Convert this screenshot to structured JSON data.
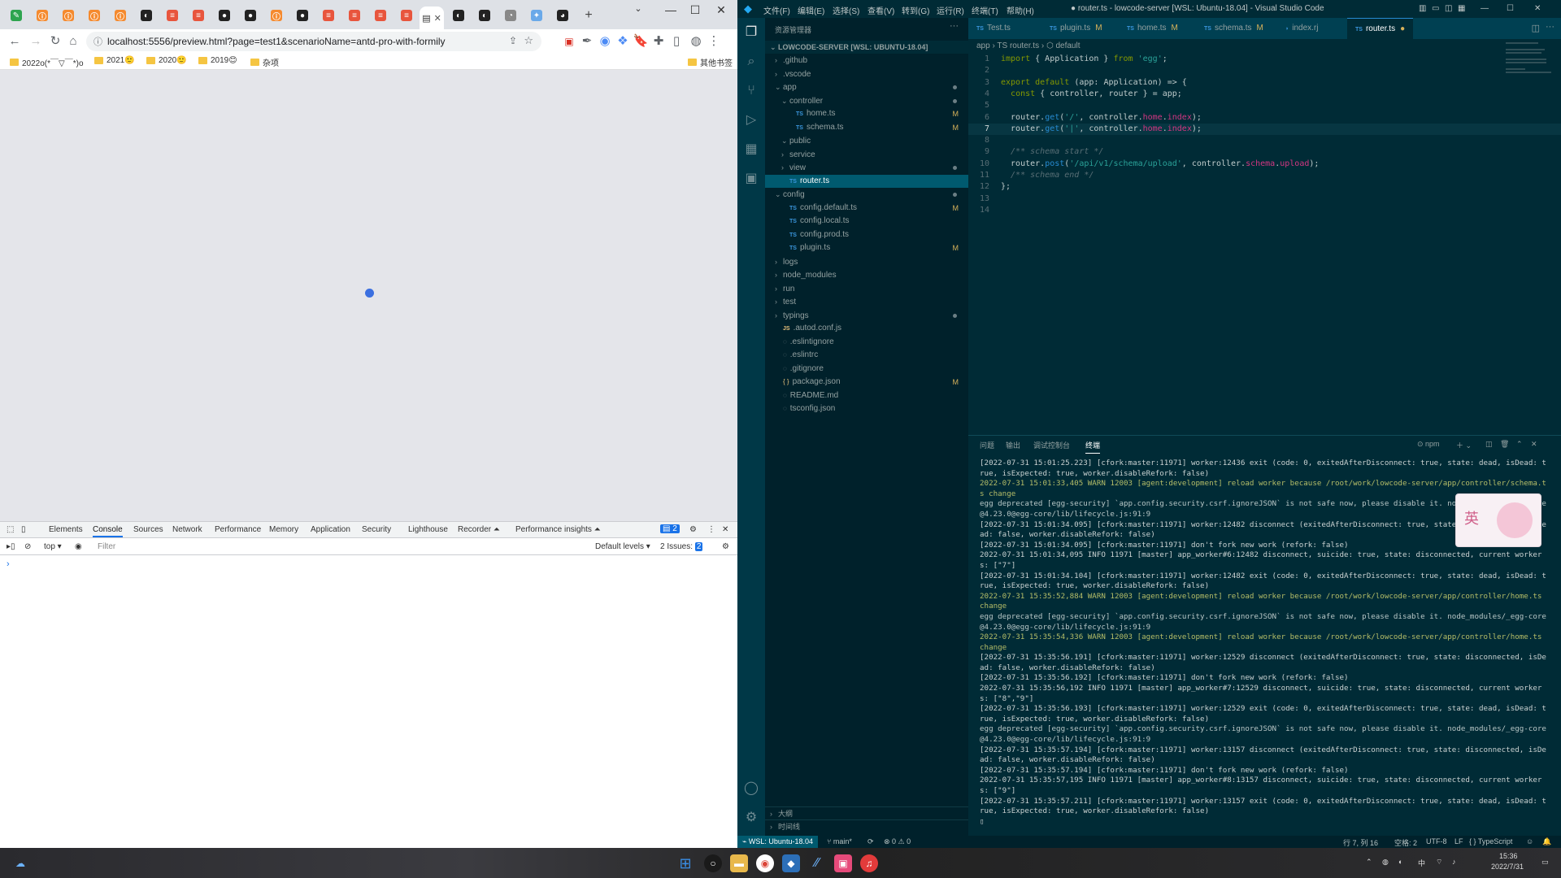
{
  "browser": {
    "address": "localhost:5556/preview.html?page=test1&scenarioName=antd-pro-with-formily",
    "window_controls": [
      "—",
      "☐",
      "✕"
    ],
    "bookmarks": [
      {
        "label": "2022o(*￣▽￣*)o"
      },
      {
        "label": "2021🙂"
      },
      {
        "label": "2020🙂"
      },
      {
        "label": "2019😊"
      },
      {
        "label": "杂项"
      }
    ],
    "other_bookmarks": "其他书签",
    "devtools": {
      "tabs": [
        "Elements",
        "Console",
        "Sources",
        "Network",
        "Performance",
        "Memory",
        "Application",
        "Security",
        "Lighthouse",
        "Recorder ⏶",
        "Performance insights ⏶"
      ],
      "active_tab": "Console",
      "badge_count": "2",
      "context": "top ▾",
      "filter_placeholder": "Filter",
      "levels": "Default levels ▾",
      "issues": "2 Issues: ",
      "issues_count": "2",
      "prompt": "›"
    }
  },
  "vscode": {
    "menu": [
      "文件(F)",
      "编辑(E)",
      "选择(S)",
      "查看(V)",
      "转到(G)",
      "运行(R)",
      "终端(T)",
      "帮助(H)"
    ],
    "title": "● router.ts - lowcode-server [WSL: Ubuntu-18.04] - Visual Studio Code",
    "sidebar_title": "资源管理器",
    "explorer_root": "LOWCODE-SERVER [WSL: UBUNTU-18.04]",
    "tree": [
      {
        "label": ".github",
        "indent": 0,
        "kind": "folder",
        "open": false
      },
      {
        "label": ".vscode",
        "indent": 0,
        "kind": "folder",
        "open": false
      },
      {
        "label": "app",
        "indent": 0,
        "kind": "folder",
        "open": true,
        "dot": true
      },
      {
        "label": "controller",
        "indent": 1,
        "kind": "folder",
        "open": true,
        "dot": true
      },
      {
        "label": "home.ts",
        "indent": 2,
        "kind": "ts",
        "git": "M"
      },
      {
        "label": "schema.ts",
        "indent": 2,
        "kind": "ts",
        "git": "M"
      },
      {
        "label": "public",
        "indent": 1,
        "kind": "folder",
        "open": true
      },
      {
        "label": "service",
        "indent": 1,
        "kind": "folder",
        "open": false
      },
      {
        "label": "view",
        "indent": 1,
        "kind": "folder",
        "open": false,
        "dot": true
      },
      {
        "label": "router.ts",
        "indent": 1,
        "kind": "ts",
        "selected": true
      },
      {
        "label": "config",
        "indent": 0,
        "kind": "folder",
        "open": true,
        "dot": true
      },
      {
        "label": "config.default.ts",
        "indent": 1,
        "kind": "ts",
        "git": "M"
      },
      {
        "label": "config.local.ts",
        "indent": 1,
        "kind": "ts"
      },
      {
        "label": "config.prod.ts",
        "indent": 1,
        "kind": "ts"
      },
      {
        "label": "plugin.ts",
        "indent": 1,
        "kind": "ts",
        "git": "M"
      },
      {
        "label": "logs",
        "indent": 0,
        "kind": "folder",
        "open": false
      },
      {
        "label": "node_modules",
        "indent": 0,
        "kind": "folder",
        "open": false
      },
      {
        "label": "run",
        "indent": 0,
        "kind": "folder",
        "open": false
      },
      {
        "label": "test",
        "indent": 0,
        "kind": "folder",
        "open": false
      },
      {
        "label": "typings",
        "indent": 0,
        "kind": "folder",
        "open": false,
        "dot": true
      },
      {
        "label": ".autod.conf.js",
        "indent": 0,
        "kind": "js"
      },
      {
        "label": ".eslintignore",
        "indent": 0,
        "kind": "misc"
      },
      {
        "label": ".eslintrc",
        "indent": 0,
        "kind": "misc"
      },
      {
        "label": ".gitignore",
        "indent": 0,
        "kind": "misc"
      },
      {
        "label": "package.json",
        "indent": 0,
        "kind": "json",
        "git": "M"
      },
      {
        "label": "README.md",
        "indent": 0,
        "kind": "misc"
      },
      {
        "label": "tsconfig.json",
        "indent": 0,
        "kind": "misc"
      }
    ],
    "outline_sections": [
      "大纲",
      "时间线"
    ],
    "editor_tabs": [
      {
        "label": "Test.ts",
        "modified": ""
      },
      {
        "label": "plugin.ts",
        "modified": "M"
      },
      {
        "label": "home.ts",
        "modified": "M"
      },
      {
        "label": "schema.ts",
        "modified": "M"
      },
      {
        "label": "index.rj",
        "modified": ""
      },
      {
        "label": "router.ts",
        "modified": "●",
        "active": true
      }
    ],
    "breadcrumb": "app › TS router.ts › ⬡ default",
    "code_lines": [
      {
        "n": "1",
        "tokens": [
          [
            "kw",
            "import"
          ],
          [
            "tx",
            " { Application } "
          ],
          [
            "kw",
            "from"
          ],
          [
            "tx",
            " "
          ],
          [
            "str",
            "'egg'"
          ],
          [
            "tx",
            ";"
          ]
        ]
      },
      {
        "n": "2",
        "tokens": []
      },
      {
        "n": "3",
        "tokens": [
          [
            "kw",
            "export default"
          ],
          [
            "tx",
            " ("
          ],
          [
            "tx",
            "app: Application) => {"
          ]
        ]
      },
      {
        "n": "4",
        "tokens": [
          [
            "tx",
            "  "
          ],
          [
            "kw",
            "const"
          ],
          [
            "tx",
            " { controller, router } = app;"
          ]
        ]
      },
      {
        "n": "5",
        "tokens": []
      },
      {
        "n": "6",
        "tokens": [
          [
            "tx",
            "  router."
          ],
          [
            "fn",
            "get"
          ],
          [
            "tx",
            "("
          ],
          [
            "str",
            "'/'"
          ],
          [
            "tx",
            ", controller."
          ],
          [
            "prop",
            "home"
          ],
          [
            "tx",
            "."
          ],
          [
            "prop",
            "index"
          ],
          [
            "tx",
            ");"
          ]
        ]
      },
      {
        "n": "7",
        "tokens": [
          [
            "tx",
            "  router."
          ],
          [
            "fn",
            "get"
          ],
          [
            "tx",
            "("
          ],
          [
            "str",
            "'|'"
          ],
          [
            "tx",
            ", controller."
          ],
          [
            "prop",
            "home"
          ],
          [
            "tx",
            "."
          ],
          [
            "prop",
            "index"
          ],
          [
            "tx",
            ");"
          ]
        ],
        "current": true
      },
      {
        "n": "8",
        "tokens": []
      },
      {
        "n": "9",
        "tokens": [
          [
            "cm",
            "  /** schema start */"
          ]
        ]
      },
      {
        "n": "10",
        "tokens": [
          [
            "tx",
            "  router."
          ],
          [
            "fn",
            "post"
          ],
          [
            "tx",
            "("
          ],
          [
            "str",
            "'/api/v1/schema/upload'"
          ],
          [
            "tx",
            ", controller."
          ],
          [
            "prop",
            "schema"
          ],
          [
            "tx",
            "."
          ],
          [
            "prop",
            "upload"
          ],
          [
            "tx",
            ");"
          ]
        ]
      },
      {
        "n": "11",
        "tokens": [
          [
            "cm",
            "  /** schema end */"
          ]
        ]
      },
      {
        "n": "12",
        "tokens": [
          [
            "tx",
            "};"
          ]
        ]
      },
      {
        "n": "13",
        "tokens": []
      },
      {
        "n": "14",
        "tokens": []
      }
    ],
    "panel_tabs": [
      "问题",
      "输出",
      "调试控制台",
      "终端"
    ],
    "panel_active": "终端",
    "terminal_shell": "npm",
    "terminal_lines": [
      {
        "c": "info",
        "t": "[2022-07-31 15:01:25.223] [cfork:master:11971] worker:12436 exit (code: 0, exitedAfterDisconnect: true, state: dead, isDead: true, isExpected: true, worker.disableRefork: false)"
      },
      {
        "c": "warn",
        "t": "2022-07-31 15:01:33,405 WARN 12003 [agent:development] reload worker because /root/work/lowcode-server/app/controller/schema.ts change"
      },
      {
        "c": "dep",
        "t": "egg deprecated [egg-security] `app.config.security.csrf.ignoreJSON` is not safe now, please disable it. node_modules/_egg-core@4.23.0@egg-core/lib/lifecycle.js:91:9"
      },
      {
        "c": "info",
        "t": "[2022-07-31 15:01:34.095] [cfork:master:11971] worker:12482 disconnect (exitedAfterDisconnect: true, state: disconnected, isDead: false, worker.disableRefork: false)"
      },
      {
        "c": "info",
        "t": "[2022-07-31 15:01:34.095] [cfork:master:11971] don't fork new work (refork: false)"
      },
      {
        "c": "info",
        "t": "2022-07-31 15:01:34,095 INFO 11971 [master] app_worker#6:12482 disconnect, suicide: true, state: disconnected, current workers: [\"7\"]"
      },
      {
        "c": "info",
        "t": "[2022-07-31 15:01:34.104] [cfork:master:11971] worker:12482 exit (code: 0, exitedAfterDisconnect: true, state: dead, isDead: true, isExpected: true, worker.disableRefork: false)"
      },
      {
        "c": "warn",
        "t": "2022-07-31 15:35:52,884 WARN 12003 [agent:development] reload worker because /root/work/lowcode-server/app/controller/home.ts change"
      },
      {
        "c": "dep",
        "t": "egg deprecated [egg-security] `app.config.security.csrf.ignoreJSON` is not safe now, please disable it. node_modules/_egg-core@4.23.0@egg-core/lib/lifecycle.js:91:9"
      },
      {
        "c": "warn",
        "t": "2022-07-31 15:35:54,336 WARN 12003 [agent:development] reload worker because /root/work/lowcode-server/app/controller/home.ts change"
      },
      {
        "c": "info",
        "t": "[2022-07-31 15:35:56.191] [cfork:master:11971] worker:12529 disconnect (exitedAfterDisconnect: true, state: disconnected, isDead: false, worker.disableRefork: false)"
      },
      {
        "c": "info",
        "t": "[2022-07-31 15:35:56.192] [cfork:master:11971] don't fork new work (refork: false)"
      },
      {
        "c": "info",
        "t": "2022-07-31 15:35:56,192 INFO 11971 [master] app_worker#7:12529 disconnect, suicide: true, state: disconnected, current workers: [\"8\",\"9\"]"
      },
      {
        "c": "info",
        "t": "[2022-07-31 15:35:56.193] [cfork:master:11971] worker:12529 exit (code: 0, exitedAfterDisconnect: true, state: dead, isDead: true, isExpected: true, worker.disableRefork: false)"
      },
      {
        "c": "dep",
        "t": "egg deprecated [egg-security] `app.config.security.csrf.ignoreJSON` is not safe now, please disable it. node_modules/_egg-core@4.23.0@egg-core/lib/lifecycle.js:91:9"
      },
      {
        "c": "info",
        "t": "[2022-07-31 15:35:57.194] [cfork:master:11971] worker:13157 disconnect (exitedAfterDisconnect: true, state: disconnected, isDead: false, worker.disableRefork: false)"
      },
      {
        "c": "info",
        "t": "[2022-07-31 15:35:57.194] [cfork:master:11971] don't fork new work (refork: false)"
      },
      {
        "c": "info",
        "t": "2022-07-31 15:35:57,195 INFO 11971 [master] app_worker#8:13157 disconnect, suicide: true, state: disconnected, current workers: [\"9\"]"
      },
      {
        "c": "info",
        "t": "[2022-07-31 15:35:57.211] [cfork:master:11971] worker:13157 exit (code: 0, exitedAfterDisconnect: true, state: dead, isDead: true, isExpected: true, worker.disableRefork: false)"
      }
    ],
    "status": {
      "remote": "WSL: Ubuntu-18.04",
      "branch": "main*",
      "problems": "⊗ 0 ⚠ 0",
      "position": "行 7, 列 16",
      "spaces": "空格: 2",
      "encoding": "UTF-8",
      "eol": "LF",
      "language": "{ } TypeScript"
    },
    "sticker_text": "英"
  },
  "taskbar": {
    "time": "15:36",
    "date": "2022/7/31"
  },
  "colors": {
    "vscode_bg": "#002b36",
    "sidebar_bg": "#00212b",
    "accent": "#268bd2",
    "browser_viewport": "#e4e5ea",
    "loader_dot": "#3b6fe0"
  }
}
